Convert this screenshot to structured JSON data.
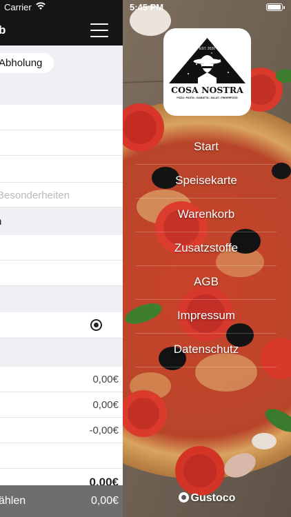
{
  "status_bar": {
    "carrier": "Carrier",
    "time": "5:45 PM"
  },
  "left_panel": {
    "title": "b",
    "pickup_option": "Abholung",
    "notes_placeholder": "Besonderheiten",
    "section_text": "n",
    "amounts": [
      "0,00€",
      "0,00€",
      "-0,00€"
    ],
    "total_partial": "0,00€",
    "bottom_bar": {
      "label": "ählen",
      "sum": "0,00€"
    }
  },
  "menu": {
    "logo": {
      "title": "COSA NOSTRA",
      "subtitle": "PIZZA • PASTA • CIABATTA • SALAT • FINGERFOOD",
      "est": "EST. 2020"
    },
    "items": [
      {
        "label": "Start"
      },
      {
        "label": "Speisekarte"
      },
      {
        "label": "Warenkorb"
      },
      {
        "label": "Zusatzstoffe"
      },
      {
        "label": "AGB"
      },
      {
        "label": "Impressum"
      },
      {
        "label": "Datenschutz"
      }
    ],
    "footer_brand": "Gustoco"
  },
  "colors": {
    "header_bg": "#151515",
    "bottom_bar_bg": "#6e6e6e",
    "group_bg": "#efeff4"
  }
}
